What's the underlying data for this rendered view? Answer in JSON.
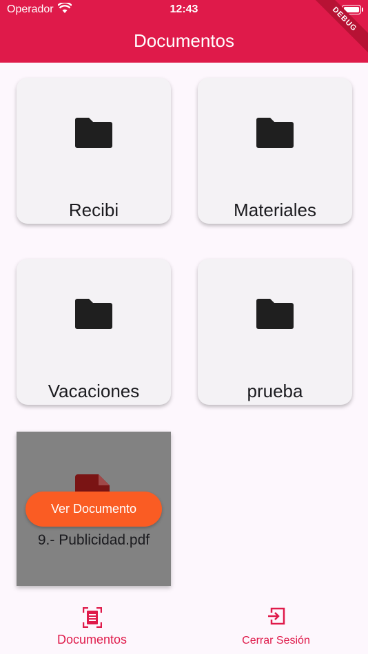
{
  "status_bar": {
    "carrier": "Operador",
    "time": "12:43"
  },
  "debug_banner": "DEBUG",
  "header": {
    "title": "Documentos"
  },
  "folders": [
    {
      "label": "Recibi",
      "icon": "folder-icon"
    },
    {
      "label": "Materiales",
      "icon": "folder-icon"
    },
    {
      "label": "Vacaciones",
      "icon": "folder-icon"
    },
    {
      "label": "prueba",
      "icon": "folder-icon"
    }
  ],
  "file": {
    "label": "9.- Publicidad.pdf",
    "icon": "pdf-file-icon",
    "action_label": "Ver Documento"
  },
  "bottom_nav": {
    "documents_label": "Documentos",
    "logout_label": "Cerrar Sesión"
  },
  "colors": {
    "primary": "#df1a4a",
    "action": "#fa5c23",
    "card": "#f4f2f5"
  }
}
